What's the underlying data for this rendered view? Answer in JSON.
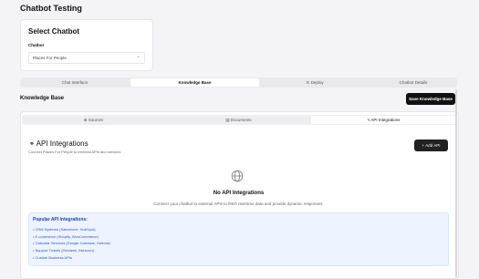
{
  "page": {
    "title": "Chatbot Testing"
  },
  "select_card": {
    "heading": "Select Chatbot",
    "label": "Chatbot",
    "value": "Places For People"
  },
  "tabs": [
    {
      "label": "Chat Interface"
    },
    {
      "label": "Knowledge Base"
    },
    {
      "label": "Deploy"
    },
    {
      "label": "Chatbot Details"
    }
  ],
  "kb": {
    "title": "Knowledge Base",
    "save_label": "Save Knowledge Base"
  },
  "subtabs": [
    {
      "label": "Sources"
    },
    {
      "label": "Documents"
    },
    {
      "label": "API Integrations"
    }
  ],
  "api": {
    "title": "API Integrations",
    "subtitle": "Connect Places For People to external APIs and services",
    "add_label": "Add API"
  },
  "empty": {
    "heading": "No API Integrations",
    "description": "Connect your chatbot to external APIs to fetch real-time data and provide dynamic responses."
  },
  "popular": {
    "heading": "Popular API Integrations:",
    "items": [
      "• CRM Systems (Salesforce, HubSpot)",
      "• E-commerce (Shopify, WooCommerce)",
      "• Calendar Services (Google Calendar, Outlook)",
      "• Support Tickets (Zendesk, Intercom)",
      "• Custom Business APIs"
    ]
  },
  "colors": {
    "accent": "#111111",
    "info_bg": "#eef4ff",
    "info_text": "#1e40af"
  }
}
